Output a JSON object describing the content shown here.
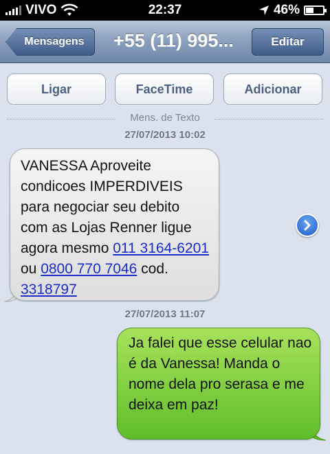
{
  "status_bar": {
    "carrier": "VIVO",
    "time": "22:37",
    "battery": "46%",
    "battery_level": 0.46
  },
  "nav": {
    "back_label": "Mensagens",
    "title": "+55 (11) 995...",
    "edit_label": "Editar"
  },
  "actions": {
    "call_label": "Ligar",
    "facetime_label": "FaceTime",
    "add_label": "Adicionar"
  },
  "conversation": {
    "type_label": "Mens. de Texto",
    "timestamp_1": "27/07/2013 10:02",
    "timestamp_2": "27/07/2013 11:07",
    "incoming": {
      "text_1": "VANESSA Aproveite condicoes IMPERDIVEIS para negociar seu debito com as Lojas Renner ligue agora mesmo ",
      "phone_1": "011 3164-6201",
      "text_2": " ou ",
      "phone_2": "0800 770 7046",
      "text_3": " cod. ",
      "code": "3318797"
    },
    "outgoing": {
      "text": "Ja falei que esse celular nao é da Vanessa! Manda o nome dela pro serasa e me deixa em paz!"
    }
  },
  "colors": {
    "outgoing_bubble": "#7fd03e",
    "incoming_bubble": "#e8e8e8",
    "link": "#1a2ccc",
    "background": "#dbe2ed"
  }
}
